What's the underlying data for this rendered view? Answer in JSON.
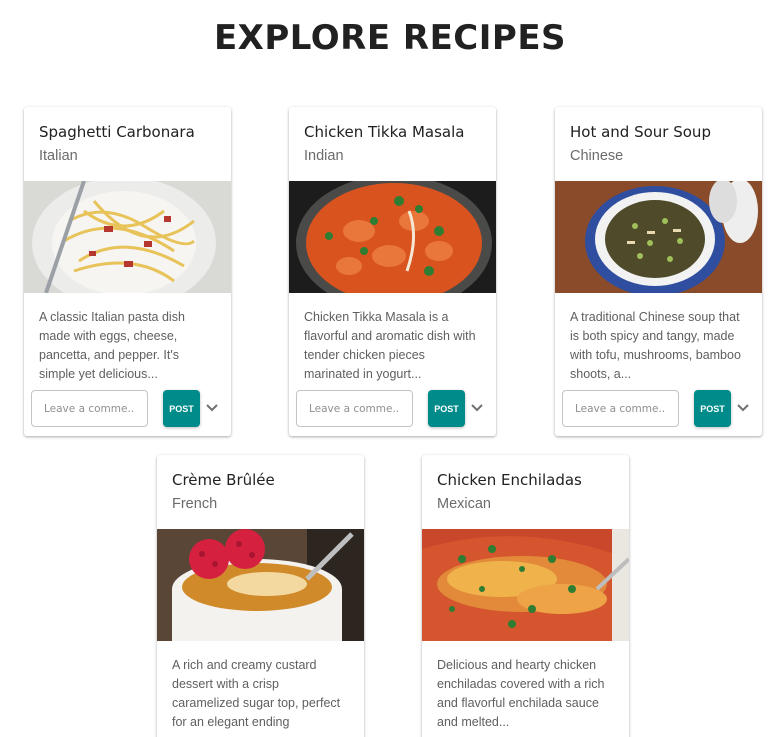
{
  "page": {
    "title": "EXPLORE RECIPES"
  },
  "colors": {
    "accent": "#008b8b",
    "text": "#212121",
    "muted": "#6b6b6b"
  },
  "actions": {
    "comment_placeholder": "Leave a comme...",
    "post_label": "POST",
    "expand_icon": "chevron-down-icon"
  },
  "recipes": [
    {
      "title": "Spaghetti Carbonara",
      "cuisine": "Italian",
      "description": "A classic Italian pasta dish made with eggs, cheese, pancetta, and pepper. It's simple yet delicious..."
    },
    {
      "title": "Chicken Tikka Masala",
      "cuisine": "Indian",
      "description": "Chicken Tikka Masala is a flavorful and aromatic dish with tender chicken pieces marinated in yogurt..."
    },
    {
      "title": "Hot and Sour Soup",
      "cuisine": "Chinese",
      "description": "A traditional Chinese soup that is both spicy and tangy, made with tofu, mushrooms, bamboo shoots, a..."
    },
    {
      "title": "Crème Brûlée",
      "cuisine": "French",
      "description": "A rich and creamy custard dessert with a crisp caramelized sugar top, perfect for an elegant ending"
    },
    {
      "title": "Chicken Enchiladas",
      "cuisine": "Mexican",
      "description": "Delicious and hearty chicken enchiladas covered with a rich and flavorful enchilada sauce and melted..."
    }
  ]
}
